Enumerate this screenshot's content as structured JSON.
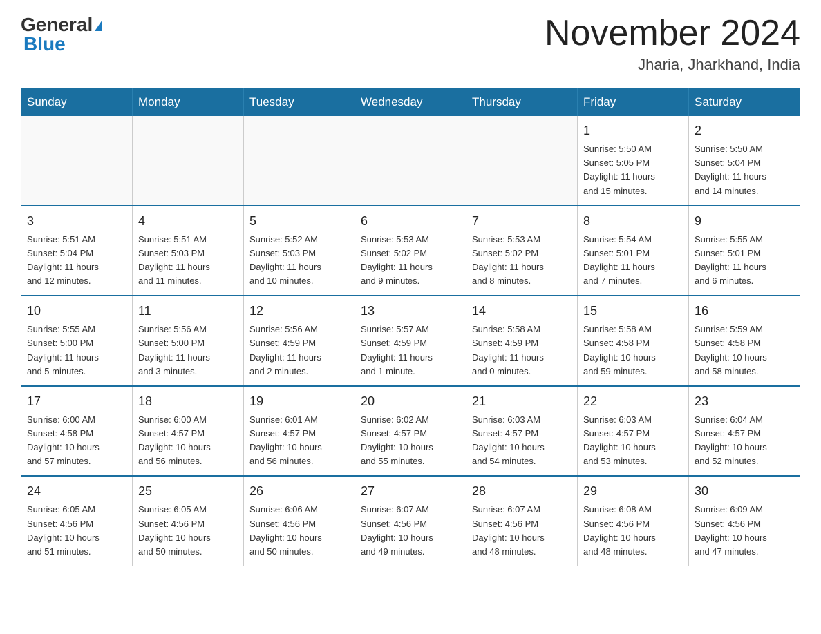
{
  "header": {
    "logo_main": "General",
    "logo_sub": "Blue",
    "month_title": "November 2024",
    "location": "Jharia, Jharkhand, India"
  },
  "weekdays": [
    "Sunday",
    "Monday",
    "Tuesday",
    "Wednesday",
    "Thursday",
    "Friday",
    "Saturday"
  ],
  "weeks": [
    [
      {
        "day": "",
        "info": ""
      },
      {
        "day": "",
        "info": ""
      },
      {
        "day": "",
        "info": ""
      },
      {
        "day": "",
        "info": ""
      },
      {
        "day": "",
        "info": ""
      },
      {
        "day": "1",
        "info": "Sunrise: 5:50 AM\nSunset: 5:05 PM\nDaylight: 11 hours\nand 15 minutes."
      },
      {
        "day": "2",
        "info": "Sunrise: 5:50 AM\nSunset: 5:04 PM\nDaylight: 11 hours\nand 14 minutes."
      }
    ],
    [
      {
        "day": "3",
        "info": "Sunrise: 5:51 AM\nSunset: 5:04 PM\nDaylight: 11 hours\nand 12 minutes."
      },
      {
        "day": "4",
        "info": "Sunrise: 5:51 AM\nSunset: 5:03 PM\nDaylight: 11 hours\nand 11 minutes."
      },
      {
        "day": "5",
        "info": "Sunrise: 5:52 AM\nSunset: 5:03 PM\nDaylight: 11 hours\nand 10 minutes."
      },
      {
        "day": "6",
        "info": "Sunrise: 5:53 AM\nSunset: 5:02 PM\nDaylight: 11 hours\nand 9 minutes."
      },
      {
        "day": "7",
        "info": "Sunrise: 5:53 AM\nSunset: 5:02 PM\nDaylight: 11 hours\nand 8 minutes."
      },
      {
        "day": "8",
        "info": "Sunrise: 5:54 AM\nSunset: 5:01 PM\nDaylight: 11 hours\nand 7 minutes."
      },
      {
        "day": "9",
        "info": "Sunrise: 5:55 AM\nSunset: 5:01 PM\nDaylight: 11 hours\nand 6 minutes."
      }
    ],
    [
      {
        "day": "10",
        "info": "Sunrise: 5:55 AM\nSunset: 5:00 PM\nDaylight: 11 hours\nand 5 minutes."
      },
      {
        "day": "11",
        "info": "Sunrise: 5:56 AM\nSunset: 5:00 PM\nDaylight: 11 hours\nand 3 minutes."
      },
      {
        "day": "12",
        "info": "Sunrise: 5:56 AM\nSunset: 4:59 PM\nDaylight: 11 hours\nand 2 minutes."
      },
      {
        "day": "13",
        "info": "Sunrise: 5:57 AM\nSunset: 4:59 PM\nDaylight: 11 hours\nand 1 minute."
      },
      {
        "day": "14",
        "info": "Sunrise: 5:58 AM\nSunset: 4:59 PM\nDaylight: 11 hours\nand 0 minutes."
      },
      {
        "day": "15",
        "info": "Sunrise: 5:58 AM\nSunset: 4:58 PM\nDaylight: 10 hours\nand 59 minutes."
      },
      {
        "day": "16",
        "info": "Sunrise: 5:59 AM\nSunset: 4:58 PM\nDaylight: 10 hours\nand 58 minutes."
      }
    ],
    [
      {
        "day": "17",
        "info": "Sunrise: 6:00 AM\nSunset: 4:58 PM\nDaylight: 10 hours\nand 57 minutes."
      },
      {
        "day": "18",
        "info": "Sunrise: 6:00 AM\nSunset: 4:57 PM\nDaylight: 10 hours\nand 56 minutes."
      },
      {
        "day": "19",
        "info": "Sunrise: 6:01 AM\nSunset: 4:57 PM\nDaylight: 10 hours\nand 56 minutes."
      },
      {
        "day": "20",
        "info": "Sunrise: 6:02 AM\nSunset: 4:57 PM\nDaylight: 10 hours\nand 55 minutes."
      },
      {
        "day": "21",
        "info": "Sunrise: 6:03 AM\nSunset: 4:57 PM\nDaylight: 10 hours\nand 54 minutes."
      },
      {
        "day": "22",
        "info": "Sunrise: 6:03 AM\nSunset: 4:57 PM\nDaylight: 10 hours\nand 53 minutes."
      },
      {
        "day": "23",
        "info": "Sunrise: 6:04 AM\nSunset: 4:57 PM\nDaylight: 10 hours\nand 52 minutes."
      }
    ],
    [
      {
        "day": "24",
        "info": "Sunrise: 6:05 AM\nSunset: 4:56 PM\nDaylight: 10 hours\nand 51 minutes."
      },
      {
        "day": "25",
        "info": "Sunrise: 6:05 AM\nSunset: 4:56 PM\nDaylight: 10 hours\nand 50 minutes."
      },
      {
        "day": "26",
        "info": "Sunrise: 6:06 AM\nSunset: 4:56 PM\nDaylight: 10 hours\nand 50 minutes."
      },
      {
        "day": "27",
        "info": "Sunrise: 6:07 AM\nSunset: 4:56 PM\nDaylight: 10 hours\nand 49 minutes."
      },
      {
        "day": "28",
        "info": "Sunrise: 6:07 AM\nSunset: 4:56 PM\nDaylight: 10 hours\nand 48 minutes."
      },
      {
        "day": "29",
        "info": "Sunrise: 6:08 AM\nSunset: 4:56 PM\nDaylight: 10 hours\nand 48 minutes."
      },
      {
        "day": "30",
        "info": "Sunrise: 6:09 AM\nSunset: 4:56 PM\nDaylight: 10 hours\nand 47 minutes."
      }
    ]
  ]
}
